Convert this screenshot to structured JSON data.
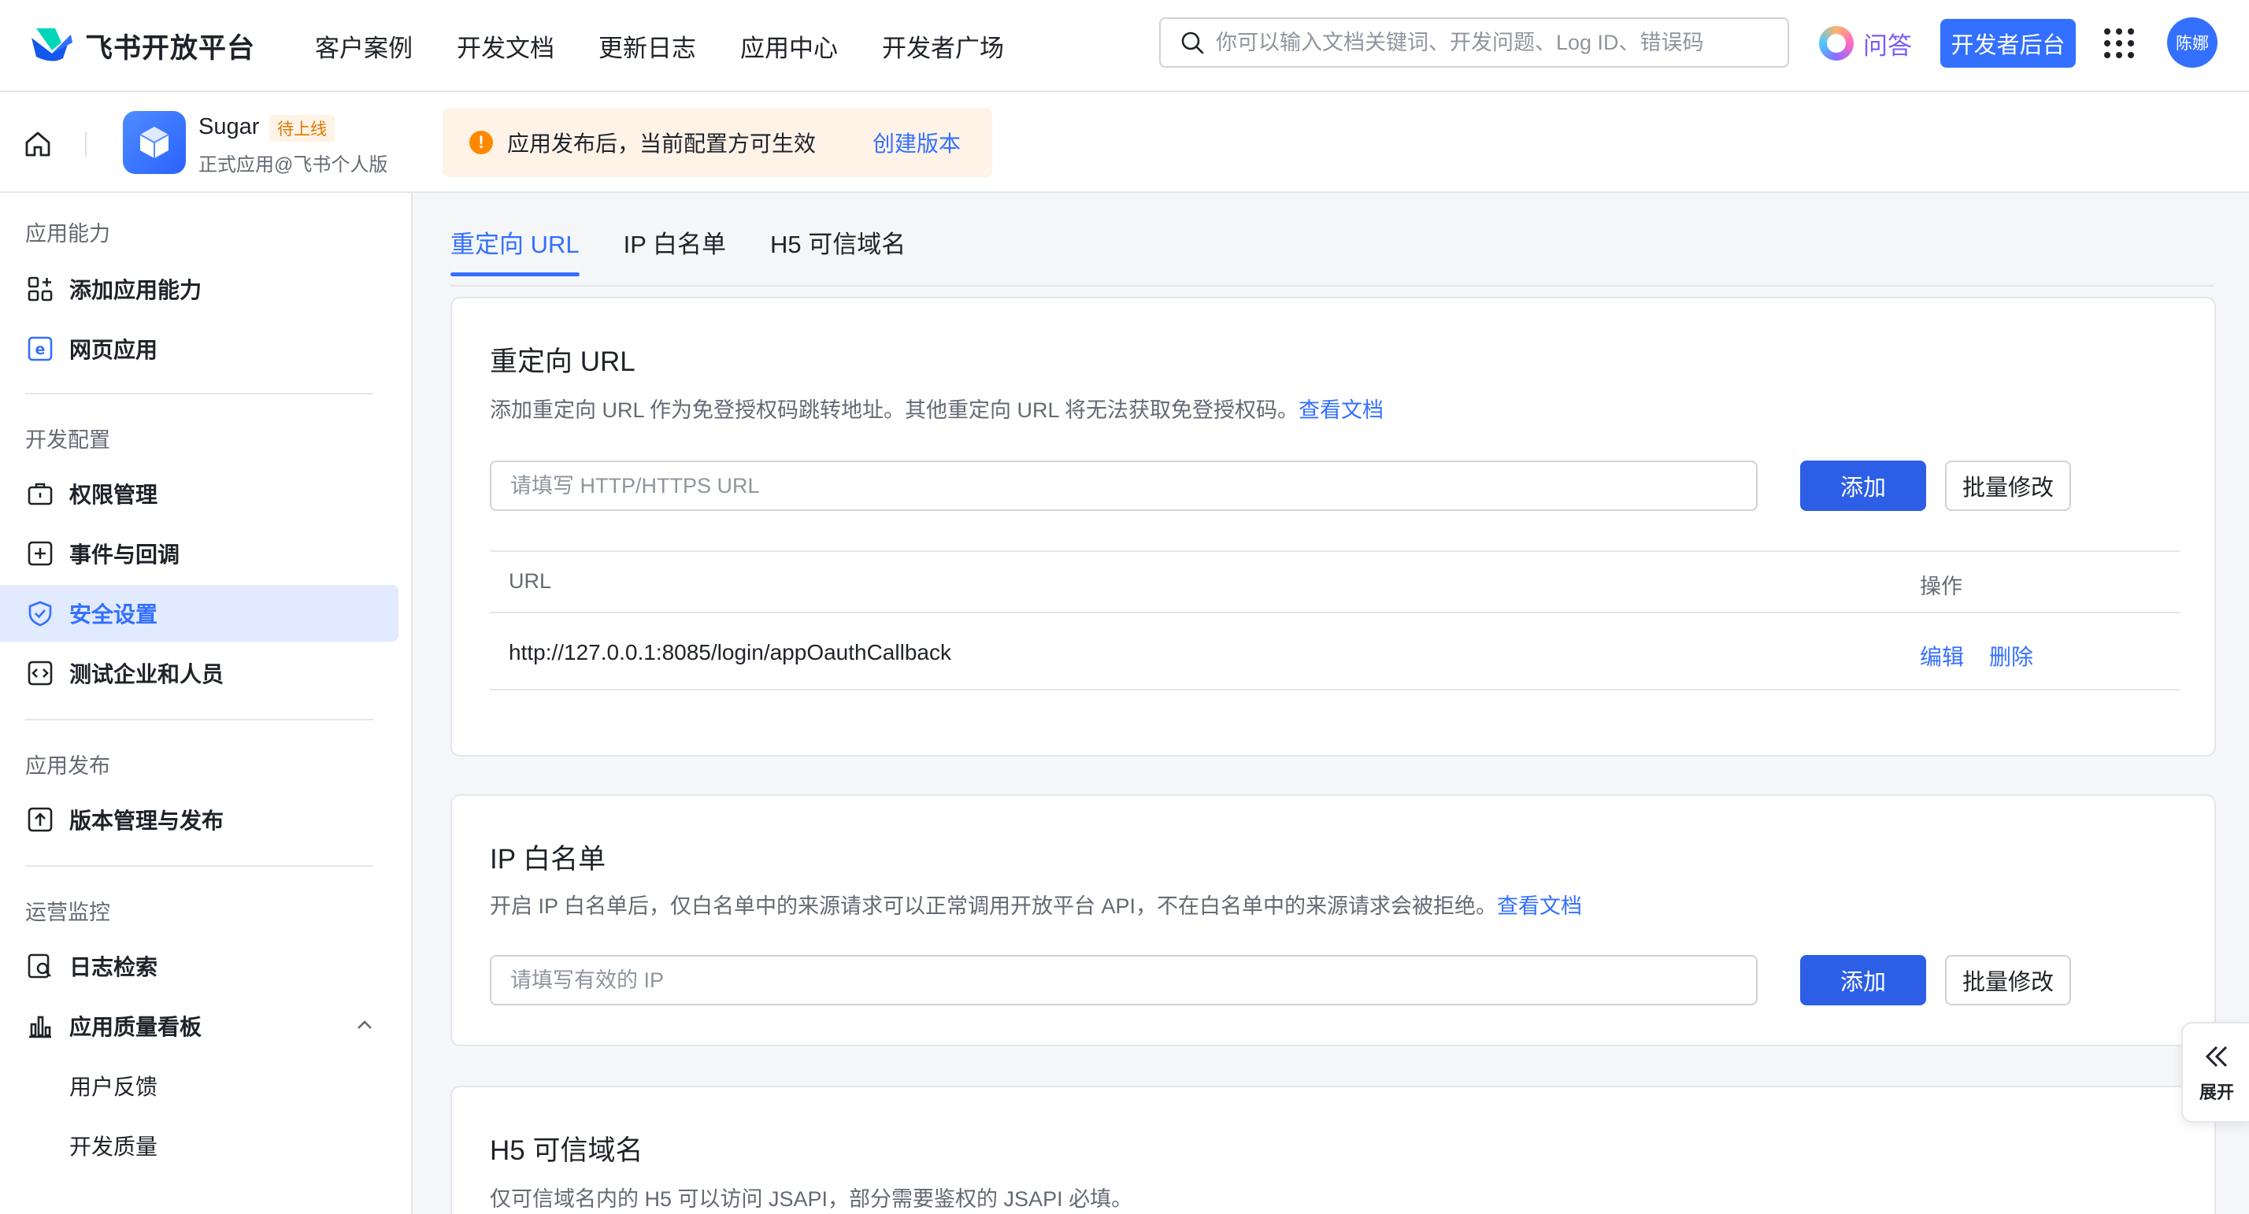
{
  "brand": {
    "name": "飞书开放平台"
  },
  "nav": {
    "items": [
      "客户案例",
      "开发文档",
      "更新日志",
      "应用中心",
      "开发者广场"
    ]
  },
  "search": {
    "placeholder": "你可以输入文档关键词、开发问题、Log ID、错误码",
    "value": ""
  },
  "header_actions": {
    "qa_label": "问答",
    "dev_console_label": "开发者后台",
    "avatar_text": "陈娜"
  },
  "app": {
    "name": "Sugar",
    "status": "待上线",
    "subtitle": "正式应用@飞书个人版",
    "notice_text": "应用发布后，当前配置方可生效",
    "notice_link": "创建版本"
  },
  "sidebar": {
    "sections": [
      {
        "title": "应用能力",
        "items": [
          "添加应用能力",
          "网页应用"
        ]
      },
      {
        "title": "开发配置",
        "items": [
          "权限管理",
          "事件与回调",
          "安全设置",
          "测试企业和人员"
        ]
      },
      {
        "title": "应用发布",
        "items": [
          "版本管理与发布"
        ]
      },
      {
        "title": "运营监控",
        "items": [
          "日志检索",
          "应用质量看板"
        ],
        "sub_items": [
          "用户反馈",
          "开发质量"
        ]
      }
    ],
    "active": "安全设置"
  },
  "tabs": [
    "重定向 URL",
    "IP 白名单",
    "H5 可信域名"
  ],
  "redirect": {
    "title": "重定向 URL",
    "desc": "添加重定向 URL 作为免登授权码跳转地址。其他重定向 URL 将无法获取免登授权码。",
    "doc_link": "查看文档",
    "input_placeholder": "请填写 HTTP/HTTPS URL",
    "add_label": "添加",
    "batch_label": "批量修改",
    "table": {
      "headers": [
        "URL",
        "操作"
      ],
      "rows": [
        {
          "url": "http://127.0.0.1:8085/login/appOauthCallback",
          "edit": "编辑",
          "delete": "删除"
        }
      ]
    }
  },
  "ip": {
    "title": "IP 白名单",
    "desc": "开启 IP 白名单后，仅白名单中的来源请求可以正常调用开放平台 API，不在白名单中的来源请求会被拒绝。",
    "doc_link": "查看文档",
    "input_placeholder": "请填写有效的 IP",
    "add_label": "添加",
    "batch_label": "批量修改"
  },
  "h5": {
    "title": "H5 可信域名",
    "desc": "仅可信域名内的 H5 可以访问 JSAPI，部分需要鉴权的 JSAPI 必填。"
  },
  "expand": {
    "label": "展开"
  },
  "colors": {
    "primary": "#3370ff",
    "warning": "#ff8800",
    "active_bg": "#e1eaff"
  }
}
